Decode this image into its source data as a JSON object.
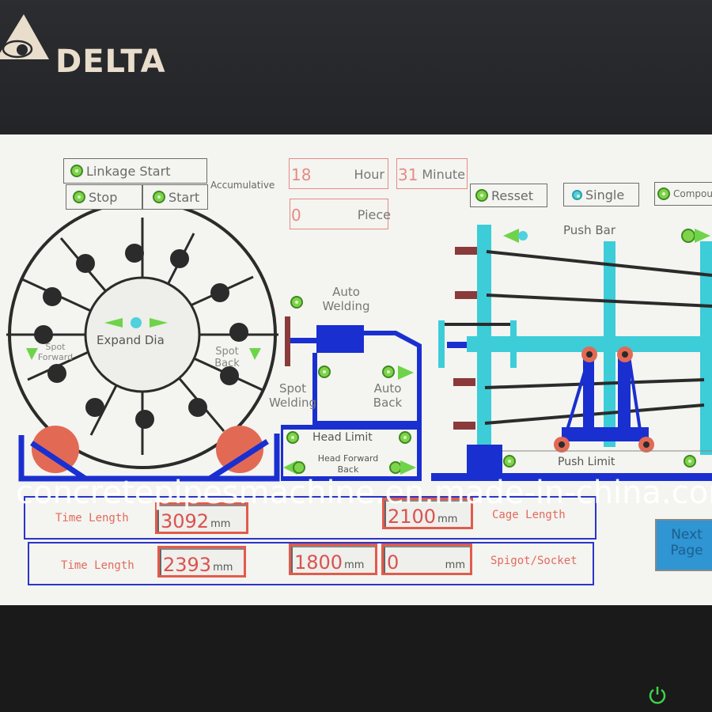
{
  "brand": {
    "name": "DELTA",
    "logo_icon": "delta-triangle-logo"
  },
  "controls": {
    "linkage_start": "Linkage Start",
    "stop": "Stop",
    "start": "Start",
    "accumulative": "Accumulative",
    "hour_value": "18",
    "hour_label": "Hour",
    "minute_value": "31",
    "minute_label": "Minute",
    "piece_value": "0",
    "piece_label": "Piece",
    "reset": "Resset",
    "single": "Single",
    "compound": "Compou"
  },
  "diagram": {
    "expand_dia": "Expand Dia",
    "spot_forward": "Spot Forward",
    "spot_back": "Spot Back",
    "auto_welding": "Auto Welding",
    "spot_welding": "Spot Welding",
    "auto_back": "Auto Back",
    "head_limit": "Head Limit",
    "head_forward_back": "Head Forward Back",
    "push_bar": "Push Bar",
    "push_limit": "Push Limit"
  },
  "settings": {
    "row1": {
      "label": "Time Length",
      "value": "3092",
      "unit": "mm",
      "cage_value": "2100",
      "cage_unit": "mm",
      "cage_label": "Cage Length"
    },
    "row2": {
      "label": "Time Length",
      "value": "2393",
      "unit": "mm",
      "value2": "1800",
      "unit2": "mm",
      "value3": "0",
      "unit3": "mm",
      "spigot_label": "Spigot/Socket"
    }
  },
  "navigation": {
    "next_page": "Next Page"
  },
  "watermark": "concretepipesmachine.en.made-in-china.com",
  "colors": {
    "accent_blue": "#1a2fd0",
    "cyan": "#3ccdd8",
    "lamp_green": "#7fd34a",
    "value_red": "#e25b4c",
    "power_green": "#3fd14a"
  }
}
